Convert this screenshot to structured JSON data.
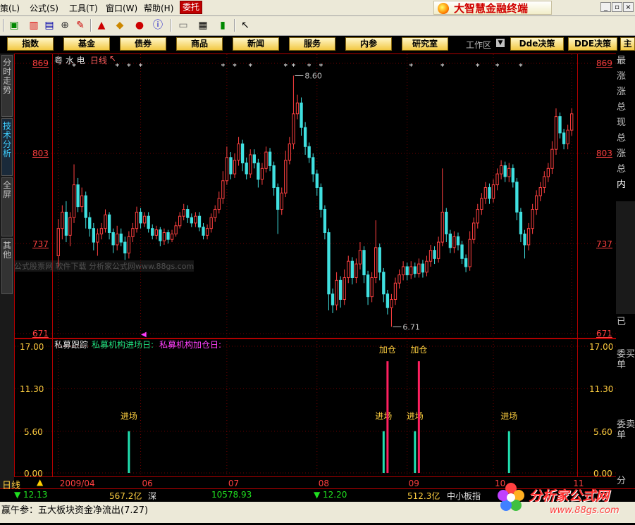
{
  "menu": {
    "items": [
      "策(L)",
      "公式(S)",
      "工具(T)",
      "窗口(W)",
      "帮助(H)"
    ],
    "active": "委托",
    "brand": "大智慧金融终端"
  },
  "navbar": {
    "buttons": [
      "指数",
      "基金",
      "债券",
      "商品",
      "新闻",
      "服务",
      "内参",
      "研究室"
    ],
    "workspace_label": "工作区",
    "right_buttons": [
      "Dde决策",
      "DDE决策",
      "主"
    ]
  },
  "left_tabs": [
    "分时走势",
    "技术分析",
    "全屏",
    "其他"
  ],
  "price_pane": {
    "stock_name": "粤 水 电",
    "period": "日线",
    "y_ticks": [
      869,
      803,
      737,
      671
    ],
    "y_range": [
      671,
      869
    ],
    "high_label": "8.60",
    "low_label": "6.71",
    "overlay_text": "公式股票网 软件下载 分析家公式网www.88gs.com"
  },
  "indicator_pane": {
    "title": "私募跟踪",
    "label_1": "私募机构进场日:",
    "label_2": "私募机构加仓日:",
    "y_ticks": [
      "17.00",
      "11.30",
      "5.60",
      "0.00"
    ],
    "y_range": [
      0,
      17
    ],
    "entry_label": "进场",
    "add_label": "加仓",
    "entries": [
      18,
      83,
      91,
      115
    ],
    "adds": [
      84,
      92
    ]
  },
  "x_axis": {
    "period_label": "日线",
    "labels": [
      {
        "i": 0,
        "t": "2009/04"
      },
      {
        "i": 21,
        "t": "06"
      },
      {
        "i": 43,
        "t": "07"
      },
      {
        "i": 66,
        "t": "08"
      },
      {
        "i": 89,
        "t": "09"
      },
      {
        "i": 111,
        "t": "10"
      },
      {
        "i": 131,
        "t": "11"
      }
    ]
  },
  "right_panel": [
    "最",
    "涨",
    "涨",
    "总",
    "现",
    "总",
    "涨",
    "总",
    "内",
    "已",
    "委买单",
    "委卖单",
    "分"
  ],
  "status": {
    "sh_index": "12.13",
    "sh_amount": "567.2亿",
    "sz_label": "深",
    "sz_index": "10578.93",
    "sz_change": "12.20",
    "sz_amount": "512.3亿",
    "board_label": "中小板指"
  },
  "news": "赢午参：五大板块资金净流出(7.27)",
  "watermark": {
    "text": "分析家公式网",
    "url": "www.88gs.com"
  },
  "colors": {
    "up": "#ff4040",
    "down": "#40e0e0",
    "border": "#b00000",
    "entry": "#20e0b0",
    "add": "#ff2060"
  },
  "chart_data": {
    "type": "candlestick",
    "y_range": [
      671,
      869
    ],
    "star_markers": [
      4,
      15,
      18,
      21,
      42,
      45,
      49,
      58,
      60,
      64,
      67,
      90,
      98,
      107,
      112,
      118
    ],
    "candles": [
      {
        "o": 728,
        "c": 748,
        "h": 755,
        "l": 720
      },
      {
        "o": 748,
        "c": 760,
        "h": 765,
        "l": 740
      },
      {
        "o": 760,
        "c": 743,
        "h": 768,
        "l": 738
      },
      {
        "o": 743,
        "c": 756,
        "h": 760,
        "l": 735
      },
      {
        "o": 756,
        "c": 780,
        "h": 795,
        "l": 752
      },
      {
        "o": 780,
        "c": 764,
        "h": 785,
        "l": 760
      },
      {
        "o": 764,
        "c": 772,
        "h": 778,
        "l": 760
      },
      {
        "o": 772,
        "c": 756,
        "h": 775,
        "l": 748
      },
      {
        "o": 756,
        "c": 748,
        "h": 760,
        "l": 742
      },
      {
        "o": 748,
        "c": 738,
        "h": 752,
        "l": 732
      },
      {
        "o": 738,
        "c": 744,
        "h": 748,
        "l": 728
      },
      {
        "o": 744,
        "c": 748,
        "h": 752,
        "l": 740
      },
      {
        "o": 748,
        "c": 758,
        "h": 762,
        "l": 745
      },
      {
        "o": 758,
        "c": 745,
        "h": 760,
        "l": 740
      },
      {
        "o": 745,
        "c": 736,
        "h": 748,
        "l": 730
      },
      {
        "o": 736,
        "c": 744,
        "h": 750,
        "l": 732
      },
      {
        "o": 744,
        "c": 738,
        "h": 748,
        "l": 735
      },
      {
        "o": 738,
        "c": 730,
        "h": 742,
        "l": 725
      },
      {
        "o": 730,
        "c": 742,
        "h": 746,
        "l": 726
      },
      {
        "o": 742,
        "c": 748,
        "h": 752,
        "l": 738
      },
      {
        "o": 748,
        "c": 760,
        "h": 764,
        "l": 745
      },
      {
        "o": 760,
        "c": 752,
        "h": 763,
        "l": 748
      },
      {
        "o": 752,
        "c": 757,
        "h": 760,
        "l": 749
      },
      {
        "o": 757,
        "c": 748,
        "h": 760,
        "l": 745
      },
      {
        "o": 748,
        "c": 743,
        "h": 751,
        "l": 740
      },
      {
        "o": 743,
        "c": 747,
        "h": 750,
        "l": 740
      },
      {
        "o": 747,
        "c": 739,
        "h": 749,
        "l": 735
      },
      {
        "o": 739,
        "c": 745,
        "h": 748,
        "l": 736
      },
      {
        "o": 745,
        "c": 740,
        "h": 747,
        "l": 737
      },
      {
        "o": 740,
        "c": 744,
        "h": 747,
        "l": 738
      },
      {
        "o": 744,
        "c": 750,
        "h": 753,
        "l": 742
      },
      {
        "o": 750,
        "c": 757,
        "h": 760,
        "l": 748
      },
      {
        "o": 757,
        "c": 762,
        "h": 766,
        "l": 754
      },
      {
        "o": 762,
        "c": 756,
        "h": 765,
        "l": 752
      },
      {
        "o": 756,
        "c": 752,
        "h": 759,
        "l": 749
      },
      {
        "o": 752,
        "c": 757,
        "h": 760,
        "l": 749
      },
      {
        "o": 757,
        "c": 749,
        "h": 760,
        "l": 746
      },
      {
        "o": 749,
        "c": 743,
        "h": 752,
        "l": 740
      },
      {
        "o": 743,
        "c": 748,
        "h": 751,
        "l": 740
      },
      {
        "o": 748,
        "c": 756,
        "h": 759,
        "l": 745
      },
      {
        "o": 756,
        "c": 762,
        "h": 765,
        "l": 753
      },
      {
        "o": 762,
        "c": 770,
        "h": 775,
        "l": 759
      },
      {
        "o": 770,
        "c": 783,
        "h": 790,
        "l": 766
      },
      {
        "o": 783,
        "c": 800,
        "h": 808,
        "l": 780
      },
      {
        "o": 800,
        "c": 788,
        "h": 804,
        "l": 784
      },
      {
        "o": 788,
        "c": 798,
        "h": 803,
        "l": 785
      },
      {
        "o": 798,
        "c": 810,
        "h": 815,
        "l": 794
      },
      {
        "o": 810,
        "c": 796,
        "h": 813,
        "l": 790
      },
      {
        "o": 796,
        "c": 788,
        "h": 800,
        "l": 784
      },
      {
        "o": 788,
        "c": 802,
        "h": 806,
        "l": 785
      },
      {
        "o": 802,
        "c": 796,
        "h": 806,
        "l": 792
      },
      {
        "o": 796,
        "c": 784,
        "h": 799,
        "l": 778
      },
      {
        "o": 784,
        "c": 792,
        "h": 796,
        "l": 780
      },
      {
        "o": 792,
        "c": 804,
        "h": 808,
        "l": 789
      },
      {
        "o": 804,
        "c": 794,
        "h": 807,
        "l": 790
      },
      {
        "o": 794,
        "c": 778,
        "h": 797,
        "l": 772
      },
      {
        "o": 778,
        "c": 762,
        "h": 781,
        "l": 744
      },
      {
        "o": 762,
        "c": 774,
        "h": 778,
        "l": 758
      },
      {
        "o": 774,
        "c": 798,
        "h": 805,
        "l": 771
      },
      {
        "o": 798,
        "c": 810,
        "h": 815,
        "l": 795
      },
      {
        "o": 810,
        "c": 832,
        "h": 860,
        "l": 806
      },
      {
        "o": 832,
        "c": 840,
        "h": 846,
        "l": 828
      },
      {
        "o": 840,
        "c": 822,
        "h": 844,
        "l": 816
      },
      {
        "o": 822,
        "c": 808,
        "h": 826,
        "l": 802
      },
      {
        "o": 808,
        "c": 800,
        "h": 811,
        "l": 796
      },
      {
        "o": 800,
        "c": 788,
        "h": 803,
        "l": 782
      },
      {
        "o": 788,
        "c": 778,
        "h": 791,
        "l": 772
      },
      {
        "o": 778,
        "c": 762,
        "h": 781,
        "l": 756
      },
      {
        "o": 762,
        "c": 745,
        "h": 765,
        "l": 740
      },
      {
        "o": 745,
        "c": 700,
        "h": 748,
        "l": 688
      },
      {
        "o": 700,
        "c": 692,
        "h": 704,
        "l": 686
      },
      {
        "o": 692,
        "c": 710,
        "h": 716,
        "l": 688
      },
      {
        "o": 710,
        "c": 696,
        "h": 713,
        "l": 690
      },
      {
        "o": 696,
        "c": 712,
        "h": 718,
        "l": 692
      },
      {
        "o": 712,
        "c": 724,
        "h": 728,
        "l": 708
      },
      {
        "o": 724,
        "c": 712,
        "h": 727,
        "l": 707
      },
      {
        "o": 712,
        "c": 722,
        "h": 726,
        "l": 708
      },
      {
        "o": 722,
        "c": 732,
        "h": 738,
        "l": 718
      },
      {
        "o": 732,
        "c": 714,
        "h": 735,
        "l": 708
      },
      {
        "o": 714,
        "c": 698,
        "h": 717,
        "l": 692
      },
      {
        "o": 698,
        "c": 712,
        "h": 716,
        "l": 694
      },
      {
        "o": 712,
        "c": 734,
        "h": 754,
        "l": 708
      },
      {
        "o": 734,
        "c": 716,
        "h": 737,
        "l": 710
      },
      {
        "o": 716,
        "c": 700,
        "h": 719,
        "l": 694
      },
      {
        "o": 700,
        "c": 690,
        "h": 703,
        "l": 685
      },
      {
        "o": 690,
        "c": 696,
        "h": 700,
        "l": 676
      },
      {
        "o": 696,
        "c": 708,
        "h": 712,
        "l": 692
      },
      {
        "o": 708,
        "c": 714,
        "h": 718,
        "l": 704
      },
      {
        "o": 714,
        "c": 720,
        "h": 724,
        "l": 710
      },
      {
        "o": 720,
        "c": 714,
        "h": 723,
        "l": 710
      },
      {
        "o": 714,
        "c": 720,
        "h": 724,
        "l": 711
      },
      {
        "o": 720,
        "c": 715,
        "h": 723,
        "l": 712
      },
      {
        "o": 715,
        "c": 722,
        "h": 726,
        "l": 712
      },
      {
        "o": 722,
        "c": 716,
        "h": 725,
        "l": 712
      },
      {
        "o": 716,
        "c": 724,
        "h": 728,
        "l": 713
      },
      {
        "o": 724,
        "c": 732,
        "h": 736,
        "l": 720
      },
      {
        "o": 732,
        "c": 726,
        "h": 735,
        "l": 722
      },
      {
        "o": 726,
        "c": 738,
        "h": 742,
        "l": 723
      },
      {
        "o": 738,
        "c": 760,
        "h": 792,
        "l": 735
      },
      {
        "o": 760,
        "c": 744,
        "h": 763,
        "l": 738
      },
      {
        "o": 744,
        "c": 734,
        "h": 747,
        "l": 730
      },
      {
        "o": 734,
        "c": 742,
        "h": 746,
        "l": 730
      },
      {
        "o": 742,
        "c": 736,
        "h": 745,
        "l": 732
      },
      {
        "o": 736,
        "c": 726,
        "h": 739,
        "l": 722
      },
      {
        "o": 726,
        "c": 720,
        "h": 729,
        "l": 716
      },
      {
        "o": 720,
        "c": 740,
        "h": 746,
        "l": 717
      },
      {
        "o": 740,
        "c": 752,
        "h": 756,
        "l": 737
      },
      {
        "o": 752,
        "c": 762,
        "h": 766,
        "l": 748
      },
      {
        "o": 762,
        "c": 770,
        "h": 774,
        "l": 758
      },
      {
        "o": 770,
        "c": 778,
        "h": 782,
        "l": 766
      },
      {
        "o": 778,
        "c": 770,
        "h": 781,
        "l": 766
      },
      {
        "o": 770,
        "c": 780,
        "h": 784,
        "l": 767
      },
      {
        "o": 780,
        "c": 788,
        "h": 792,
        "l": 776
      },
      {
        "o": 788,
        "c": 794,
        "h": 798,
        "l": 784
      },
      {
        "o": 794,
        "c": 786,
        "h": 797,
        "l": 782
      },
      {
        "o": 786,
        "c": 792,
        "h": 796,
        "l": 782
      },
      {
        "o": 792,
        "c": 782,
        "h": 795,
        "l": 778
      },
      {
        "o": 782,
        "c": 760,
        "h": 785,
        "l": 754
      },
      {
        "o": 760,
        "c": 744,
        "h": 763,
        "l": 738
      },
      {
        "o": 744,
        "c": 736,
        "h": 747,
        "l": 726
      },
      {
        "o": 736,
        "c": 748,
        "h": 752,
        "l": 732
      },
      {
        "o": 748,
        "c": 762,
        "h": 766,
        "l": 744
      },
      {
        "o": 762,
        "c": 772,
        "h": 776,
        "l": 758
      },
      {
        "o": 772,
        "c": 778,
        "h": 782,
        "l": 768
      },
      {
        "o": 778,
        "c": 786,
        "h": 790,
        "l": 774
      },
      {
        "o": 786,
        "c": 792,
        "h": 796,
        "l": 782
      },
      {
        "o": 792,
        "c": 806,
        "h": 812,
        "l": 788
      },
      {
        "o": 806,
        "c": 830,
        "h": 836,
        "l": 802
      },
      {
        "o": 830,
        "c": 818,
        "h": 833,
        "l": 814
      },
      {
        "o": 818,
        "c": 810,
        "h": 821,
        "l": 806
      },
      {
        "o": 810,
        "c": 820,
        "h": 824,
        "l": 806
      },
      {
        "o": 820,
        "c": 832,
        "h": 836,
        "l": 816
      }
    ]
  }
}
